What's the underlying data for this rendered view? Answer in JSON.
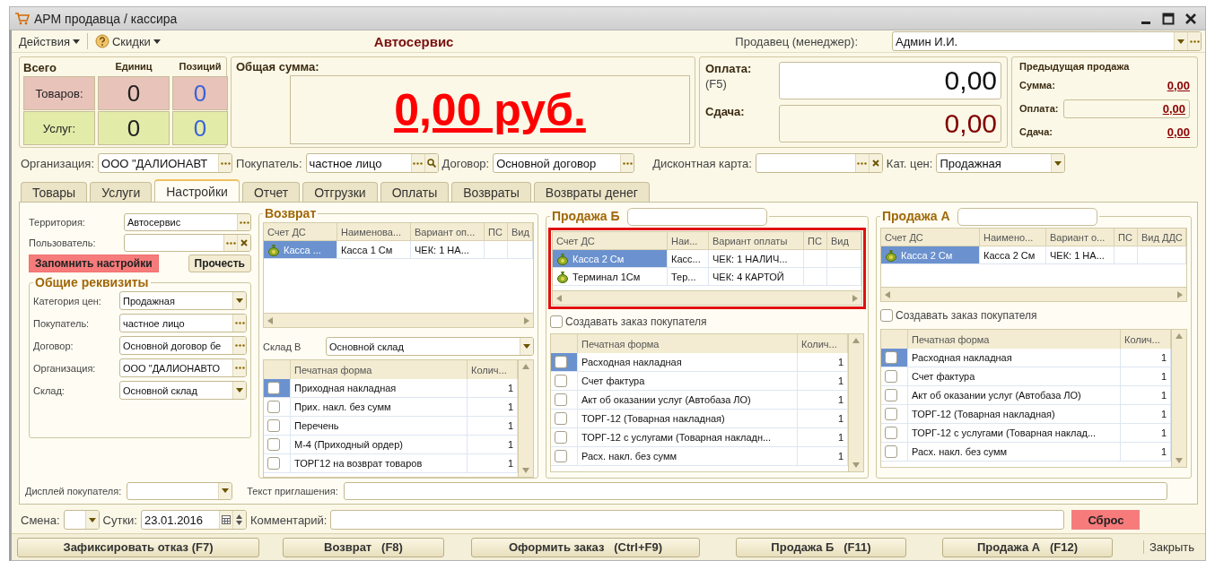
{
  "window": {
    "title": "АРМ продавца / кассира"
  },
  "toolbar": {
    "menus": [
      {
        "label": "Действия",
        "kind": "menu"
      },
      {
        "label": "Скидки",
        "kind": "help-menu"
      }
    ],
    "title": "Автосервис",
    "seller": {
      "label": "Продавец (менеджер):",
      "value": "Админ И.И.",
      "kind": "select-lookup"
    }
  },
  "totals": {
    "title": "Всего",
    "columns": [
      "Единиц",
      "Позиций"
    ],
    "rows": [
      {
        "label": "Товаров:",
        "units": "0",
        "positions": "0",
        "color": "#e8c3ba"
      },
      {
        "label": "Услуг:",
        "units": "0",
        "positions": "0",
        "color": "#e3eba9"
      }
    ]
  },
  "total_sum": {
    "label": "Общая сумма:",
    "value": "0,00 руб."
  },
  "payment": {
    "label": "Оплата:",
    "hint": "(F5)",
    "value": "0,00"
  },
  "change": {
    "label": "Сдача:",
    "value": "0,00"
  },
  "previous_sale": {
    "title": "Предыдущая продажа",
    "rows": [
      {
        "label": "Сумма:",
        "value": "0,00",
        "kind": "plain"
      },
      {
        "label": "Оплата:",
        "value": "0,00",
        "kind": "field"
      },
      {
        "label": "Сдача:",
        "value": "0,00",
        "kind": "plain"
      }
    ]
  },
  "filters": [
    {
      "label": "Организация:",
      "value": "ООО \"ДАЛИОНАВТ",
      "kind": "lookup"
    },
    {
      "label": "Покупатель:",
      "value": "частное лицо",
      "kind": "lookup-search"
    },
    {
      "label": "Договор:",
      "value": "Основной договор",
      "kind": "lookup"
    },
    {
      "label": "Дисконтная карта:",
      "kind": "lookup-clear"
    },
    {
      "label": "Кат. цен:",
      "value": "Продажная",
      "kind": "select"
    }
  ],
  "tabs": [
    {
      "label": "Товары",
      "selected": false
    },
    {
      "label": "Услуги",
      "selected": false
    },
    {
      "label": "Настройки",
      "selected": true
    },
    {
      "label": "Отчет",
      "selected": false
    },
    {
      "label": "Отгрузки",
      "selected": false
    },
    {
      "label": "Оплаты",
      "selected": false
    },
    {
      "label": "Возвраты",
      "selected": false
    },
    {
      "label": "Возвраты денег",
      "selected": false
    }
  ],
  "settings": {
    "fields": [
      {
        "label": "Территория:",
        "value": "Автосервис",
        "kind": "lookup"
      },
      {
        "label": "Пользователь:",
        "kind": "lookup-clear"
      }
    ],
    "buttons": [
      {
        "label": "Запомнить настройки",
        "kind": "alert"
      },
      {
        "label": "Прочесть",
        "kind": "normal"
      }
    ],
    "group": {
      "title": "Общие реквизиты",
      "fields": [
        {
          "label": "Категория цен:",
          "value": "Продажная",
          "kind": "select"
        },
        {
          "label": "Покупатель:",
          "value": "частное лицо",
          "kind": "lookup"
        },
        {
          "label": "Договор:",
          "value": "Основной договор бе",
          "kind": "lookup"
        },
        {
          "label": "Организация:",
          "value": "ООО \"ДАЛИОНАВТО",
          "kind": "lookup"
        },
        {
          "label": "Склад:",
          "value": "Основной склад",
          "kind": "select"
        }
      ]
    }
  },
  "return": {
    "title": "Возврат",
    "accounts": {
      "columns": [
        "Счет ДС",
        "Наименова...",
        "Вариант оп...",
        "ПС",
        "Вид"
      ],
      "rows": [
        {
          "account": "Касса ...",
          "name": "Касса 1 См",
          "payment": "ЧЕК: 1 НА...",
          "selected": true
        }
      ]
    },
    "warehouse": {
      "label": "Склад В",
      "value": "Основной склад",
      "kind": "select"
    },
    "print_forms": {
      "columns": [
        "Печатная форма",
        "Колич..."
      ],
      "rows": [
        {
          "name": "Приходная накладная",
          "count": "1",
          "checked": false,
          "selected": true
        },
        {
          "name": "Прих. накл. без сумм",
          "count": "1",
          "checked": false,
          "selected": false
        },
        {
          "name": "Перечень",
          "count": "1",
          "checked": false,
          "selected": false
        },
        {
          "name": "М-4 (Приходный ордер)",
          "count": "1",
          "checked": false,
          "selected": false
        },
        {
          "name": "ТОРГ12 на возврат товаров",
          "count": "1",
          "checked": false,
          "selected": false
        }
      ]
    }
  },
  "sales": [
    {
      "title": "Продажа Б",
      "highlighted": true,
      "accounts": {
        "columns": [
          "Счет ДС",
          "Наи...",
          "Вариант оплаты",
          "ПС",
          "Вид"
        ],
        "rows": [
          {
            "account": "Касса 2 См",
            "name": "Касс...",
            "payment": "ЧЕК: 1 НАЛИЧ...",
            "selected": true
          },
          {
            "account": "Терминал 1См",
            "name": "Тер...",
            "payment": "ЧЕК: 4 КАРТОЙ",
            "selected": false
          }
        ]
      },
      "create_order": {
        "label": "Создавать заказ покупателя",
        "checked": false
      },
      "print_forms": {
        "columns": [
          "Печатная форма",
          "Колич..."
        ],
        "rows": [
          {
            "name": "Расходная накладная",
            "count": "1",
            "checked": false,
            "selected": true
          },
          {
            "name": "Счет фактура",
            "count": "1",
            "checked": false,
            "selected": false
          },
          {
            "name": "Акт об оказании услуг (Автобаза ЛО)",
            "count": "1",
            "checked": false,
            "selected": false
          },
          {
            "name": "ТОРГ-12 (Товарная накладная)",
            "count": "1",
            "checked": false,
            "selected": false
          },
          {
            "name": "ТОРГ-12 с услугами (Товарная накладн...",
            "count": "1",
            "checked": false,
            "selected": false
          },
          {
            "name": "Расх. накл. без сумм",
            "count": "1",
            "checked": false,
            "selected": false
          }
        ]
      }
    },
    {
      "title": "Продажа А",
      "highlighted": false,
      "accounts": {
        "columns": [
          "Счет ДС",
          "Наимено...",
          "Вариант о...",
          "ПС",
          "Вид ДДС"
        ],
        "rows": [
          {
            "account": "Касса 2 См",
            "name": "Касса 2 См",
            "payment": "ЧЕК: 1 НА...",
            "selected": true
          }
        ]
      },
      "create_order": {
        "label": "Создавать заказ покупателя",
        "checked": false
      },
      "print_forms": {
        "columns": [
          "Печатная форма",
          "Колич..."
        ],
        "rows": [
          {
            "name": "Расходная накладная",
            "count": "1",
            "checked": false,
            "selected": true
          },
          {
            "name": "Счет фактура",
            "count": "1",
            "checked": false,
            "selected": false
          },
          {
            "name": "Акт об оказании услуг (Автобаза ЛО)",
            "count": "1",
            "checked": false,
            "selected": false
          },
          {
            "name": "ТОРГ-12 (Товарная накладная)",
            "count": "1",
            "checked": false,
            "selected": false
          },
          {
            "name": "ТОРГ-12 с услугами (Товарная наклад...",
            "count": "1",
            "checked": false,
            "selected": false
          },
          {
            "name": "Расх. накл. без сумм",
            "count": "1",
            "checked": false,
            "selected": false
          }
        ]
      }
    }
  ],
  "customer_display": {
    "label": "Дисплей покупателя:",
    "kind": "select"
  },
  "invitation": {
    "label": "Текст приглашения:"
  },
  "shift": {
    "label": "Смена:",
    "kind": "select"
  },
  "day": {
    "label": "Сутки:",
    "value": "23.01.2016",
    "kind": "date"
  },
  "comment": {
    "label": "Комментарий:"
  },
  "reset": {
    "label": "Сброс"
  },
  "actions": [
    {
      "label": "Зафиксировать отказ (F7)"
    },
    {
      "label": "Возврат   (F8)"
    },
    {
      "label": "Оформить заказ   (Ctrl+F9)"
    },
    {
      "label": "Продажа Б   (F11)"
    },
    {
      "label": "Продажа А   (F12)"
    }
  ],
  "close": {
    "label": "Закрыть"
  }
}
